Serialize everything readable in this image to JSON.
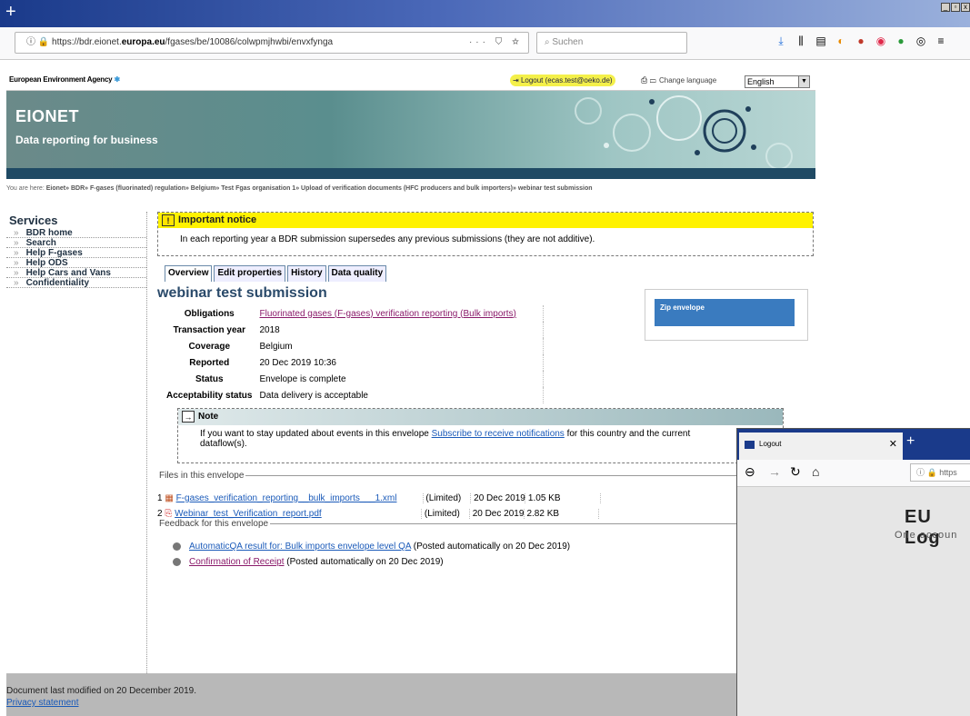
{
  "browser": {
    "newtab_glyph": "+",
    "url_host_prefix": "https://bdr.eionet.",
    "url_host_bold": "europa.eu",
    "url_path": "/fgases/be/10086/colwpmjhwbi/envxfynga",
    "url_actions": "··· ⛉ ☆",
    "search_placeholder": "Suchen"
  },
  "site": {
    "agency": "European Environment Agency",
    "logout": "Logout (ecas.test@oeko.de)",
    "change_language": "Change language",
    "language": "English",
    "brand": "EIONET",
    "tagline": "Data reporting for business",
    "breadcrumb_prefix": "You are here:",
    "breadcrumb": "Eionet» BDR» F-gases (fluorinated) regulation» Belgium» Test Fgas organisation 1» Upload of verification documents (HFC producers and bulk importers)» webinar test submission"
  },
  "sidebar": {
    "title": "Services",
    "items": [
      "BDR home",
      "Search",
      "Help F-gases",
      "Help ODS",
      "Help Cars and Vans",
      "Confidentiality"
    ]
  },
  "notice": {
    "title": "Important notice",
    "text": "In each reporting year a BDR submission supersedes any previous submissions (they are not additive)."
  },
  "tabs": [
    "Overview",
    "Edit properties",
    "History",
    "Data quality"
  ],
  "envelope": {
    "title": "webinar test submission",
    "props": [
      {
        "k": "Obligations",
        "v": "Fluorinated gases (F-gases) verification reporting (Bulk imports)"
      },
      {
        "k": "Transaction year",
        "v": "2018"
      },
      {
        "k": "Coverage",
        "v": "Belgium"
      },
      {
        "k": "Reported",
        "v": "20 Dec 2019 10:36"
      },
      {
        "k": "Status",
        "v": "Envelope is complete"
      },
      {
        "k": "Acceptability status",
        "v": "Data delivery is acceptable"
      }
    ],
    "zip_label": "Zip envelope"
  },
  "note": {
    "title": "Note",
    "text1": "If you want to stay updated about events in this envelope",
    "link": "Subscribe to receive notifications",
    "text2": "for this country and the current",
    "text3": "dataflow(s)."
  },
  "files": {
    "legend": "Files in this envelope",
    "rows": [
      {
        "n": "1",
        "name": "F-gases_verification_reporting__bulk_imports___1.xml",
        "access": "(Limited)",
        "date": "20 Dec 2019",
        "size": "1.05 KB"
      },
      {
        "n": "2",
        "name": "Webinar_test_Verification_report.pdf",
        "access": "(Limited)",
        "date": "20 Dec 2019",
        "size": "2.82 KB"
      }
    ]
  },
  "feedback": {
    "legend": "Feedback for this envelope",
    "rows": [
      {
        "link": "AutomaticQA result for: Bulk imports envelope level QA",
        "tail": "(Posted automatically on 20 Dec 2019)"
      },
      {
        "link": "Confirmation of Receipt",
        "tail": "(Posted automatically on 20 Dec 2019)"
      }
    ]
  },
  "footer": {
    "modified": "Document last modified on 20 December 2019.",
    "privacy": "Privacy statement"
  },
  "popup": {
    "tab_title": "Logout",
    "url": "https",
    "heading": "EU Log",
    "sub": "One accoun"
  }
}
